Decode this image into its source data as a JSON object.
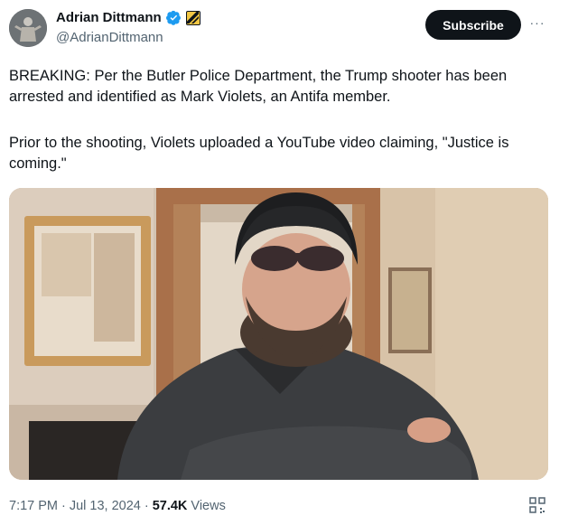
{
  "author": {
    "display_name": "Adrian Dittmann",
    "handle": "@AdrianDittmann",
    "avatar_icon": "profile-statue-avatar",
    "verified_icon": "verified-badge-icon",
    "affiliation_icon": "affiliate-badge-icon"
  },
  "actions": {
    "subscribe_label": "Subscribe",
    "more_label": "···"
  },
  "post": {
    "paragraph_1": "BREAKING: Per the Butler Police Department, the Trump shooter has been arrested and identified as Mark Violets, an Antifa member.",
    "paragraph_2": "Prior to the shooting, Violets uploaded a YouTube video claiming, \"Justice is coming.\"",
    "media": "photo-man-in-beanie-and-sunglasses"
  },
  "footer": {
    "time": "7:17 PM",
    "separator": "·",
    "date": "Jul 13, 2024",
    "views_count": "57.4K",
    "views_label": "Views"
  },
  "colors": {
    "text": "#0f1419",
    "muted": "#536471",
    "verified": "#1d9bf0",
    "button": "#0f1419"
  }
}
